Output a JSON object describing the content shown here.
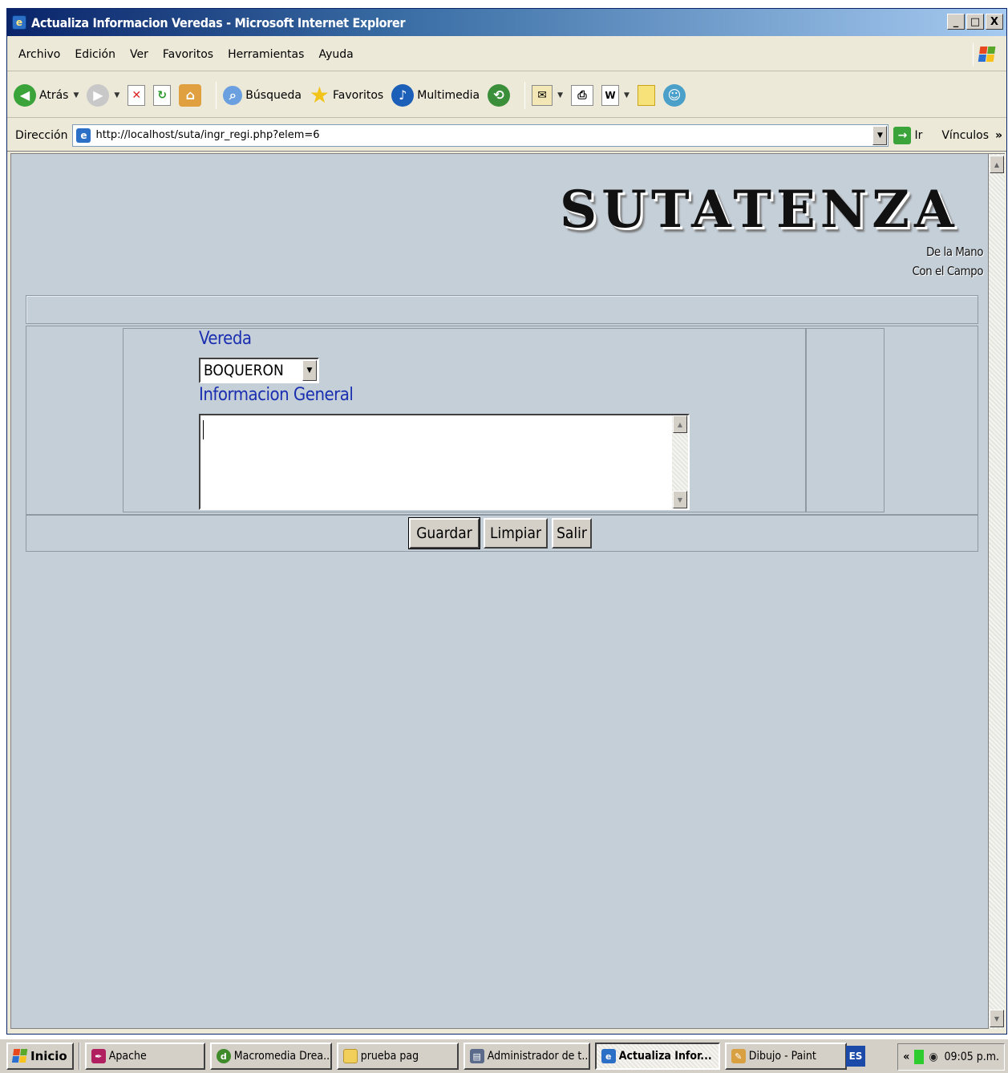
{
  "window": {
    "title": "Actualiza Informacion Veredas - Microsoft Internet Explorer",
    "caption_buttons": [
      "_",
      "□",
      "X"
    ]
  },
  "menubar": {
    "items": [
      "Archivo",
      "Edición",
      "Ver",
      "Favoritos",
      "Herramientas",
      "Ayuda"
    ]
  },
  "toolbar": {
    "back_label": "Atrás",
    "search_label": "Búsqueda",
    "favorites_label": "Favoritos",
    "media_label": "Multimedia"
  },
  "addressbar": {
    "label": "Dirección",
    "url": "http://localhost/suta/ingr_regi.php?elem=6",
    "go_label": "Ir",
    "links_label": "Vínculos",
    "links_chevron": "»"
  },
  "page": {
    "logo_text": "SUTATENZA",
    "tagline_line1": "De la Mano",
    "tagline_line2": "Con el Campo",
    "vereda_label": "Vereda",
    "vereda_selected": "BOQUERON",
    "info_label": "Informacion General",
    "info_value": "",
    "buttons": {
      "save": "Guardar",
      "clear": "Limpiar",
      "exit": "Salir"
    }
  },
  "taskbar": {
    "start_label": "Inicio",
    "tasks": [
      "Apache",
      "Macromedia Drea...",
      "prueba pag",
      "Administrador de t...",
      "Actualiza Infor...",
      "Dibujo - Paint"
    ],
    "language": "ES",
    "tray_chevron": "«",
    "clock": "09:05 p.m."
  },
  "colors": {
    "page_background": "#c5cfd8",
    "label_blue": "#1a2eb0",
    "titlebar_start": "#0a246a",
    "titlebar_end": "#a6caf0"
  }
}
